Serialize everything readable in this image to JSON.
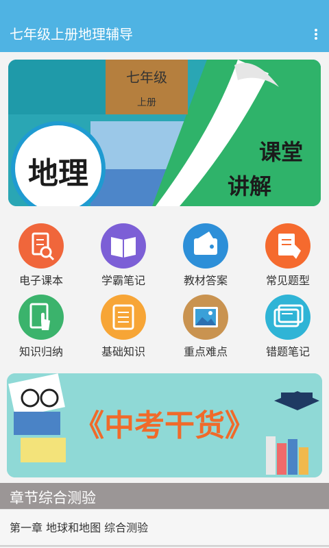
{
  "app": {
    "title": "七年级上册地理辅导"
  },
  "hero": {
    "grade": "七年级",
    "volume": "上册",
    "subject": "地理",
    "tag_line1": "课堂",
    "tag_line2": "讲解"
  },
  "grid": [
    {
      "label": "电子课本",
      "icon": "magnifier-doc-icon",
      "color": "#f0663b"
    },
    {
      "label": "学霸笔记",
      "icon": "open-book-icon",
      "color": "#7c5fd6"
    },
    {
      "label": "教材答案",
      "icon": "wallet-icon",
      "color": "#2d8fd8"
    },
    {
      "label": "常见题型",
      "icon": "pencil-doc-icon",
      "color": "#f56a2e"
    },
    {
      "label": "知识归纳",
      "icon": "hand-doc-icon",
      "color": "#3bb36c"
    },
    {
      "label": "基础知识",
      "icon": "list-doc-icon",
      "color": "#f7a536"
    },
    {
      "label": "重点难点",
      "icon": "picture-icon",
      "color": "#c99350"
    },
    {
      "label": "错题笔记",
      "icon": "cards-icon",
      "color": "#2fb4d6"
    }
  ],
  "banner": {
    "title": "《中考干货》"
  },
  "section": {
    "title": "章节综合测验"
  },
  "list": [
    {
      "label": "第一章  地球和地图   综合测验"
    }
  ]
}
